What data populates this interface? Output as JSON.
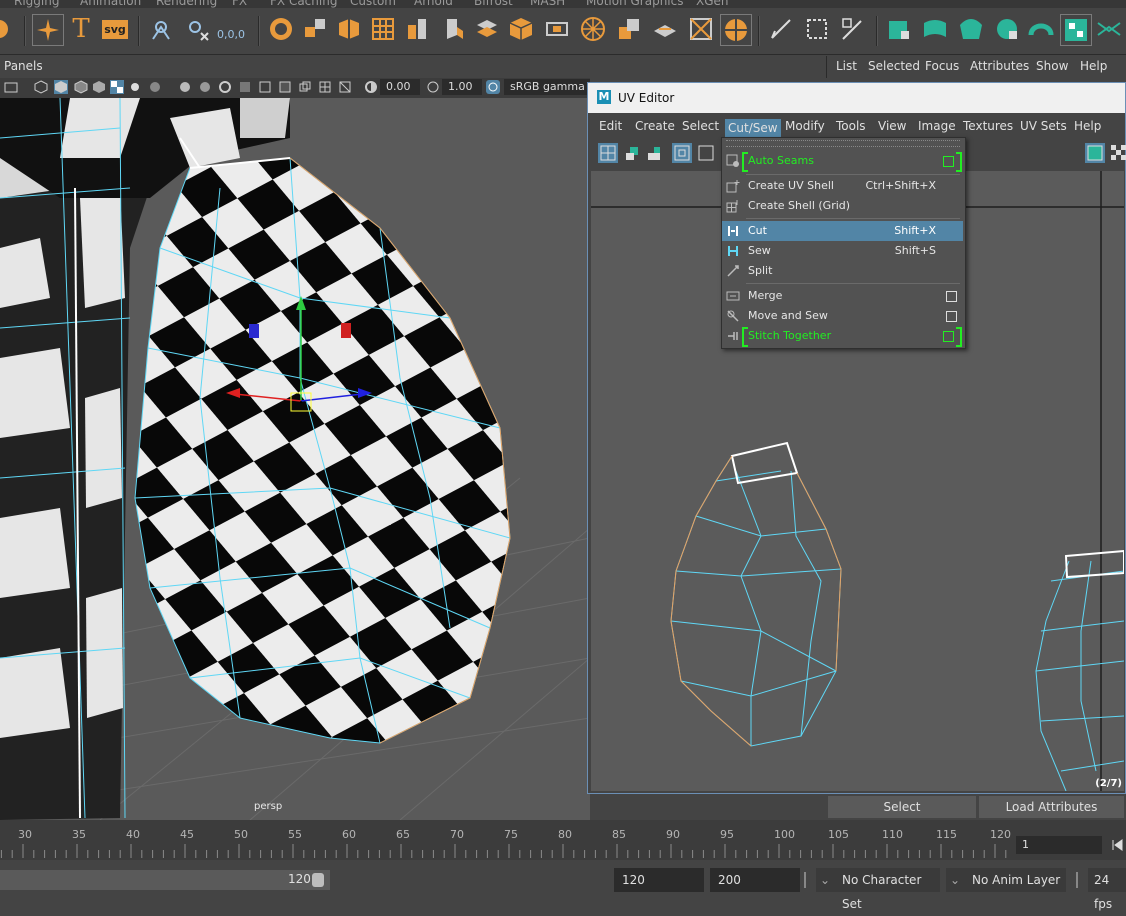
{
  "shelf_tabs": [
    "Rigging",
    "Animation",
    "Rendering",
    "FX",
    "FX Caching",
    "Custom",
    "Arnold",
    "Bifrost",
    "MASH",
    "Motion Graphics",
    "XGen"
  ],
  "shelf": {
    "text_tool_label": "T",
    "svg_tool_label": "svg",
    "snap_coords_label": "0,0,0"
  },
  "panel_menu": {
    "panels": "Panels"
  },
  "right_menu": {
    "items": [
      "List",
      "Selected",
      "Focus",
      "Attributes",
      "Show",
      "Help"
    ]
  },
  "panel_toolbar": {
    "exposure": "0.00",
    "gamma": "1.00",
    "color_space": "sRGB gamma"
  },
  "viewport": {
    "camera_label": "persp"
  },
  "uv_editor": {
    "title": "UV Editor",
    "menus": [
      "Edit",
      "Create",
      "Select",
      "Cut/Sew",
      "Modify",
      "Tools",
      "View",
      "Image",
      "Textures",
      "UV Sets",
      "Help"
    ],
    "active_menu": "Cut/Sew",
    "page_indicator": "(2/7)"
  },
  "cutsew_menu": {
    "auto_seams": "Auto Seams",
    "create_uv_shell": "Create UV Shell",
    "create_uv_shell_shortcut": "Ctrl+Shift+X",
    "create_shell_grid": "Create Shell (Grid)",
    "cut": "Cut",
    "cut_shortcut": "Shift+X",
    "sew": "Sew",
    "sew_shortcut": "Shift+S",
    "split": "Split",
    "merge": "Merge",
    "move_and_sew": "Move and Sew",
    "stitch_together": "Stitch Together"
  },
  "right_bottom": {
    "select": "Select",
    "load_attributes": "Load Attributes"
  },
  "timeline": {
    "ticks": [
      "30",
      "35",
      "40",
      "45",
      "50",
      "55",
      "60",
      "65",
      "70",
      "75",
      "80",
      "85",
      "90",
      "95",
      "100",
      "105",
      "110",
      "115",
      "120"
    ],
    "current_frame": "1"
  },
  "range_bar": {
    "range_end_slider": "120",
    "playback_end": "120",
    "anim_end": "200",
    "character_set": "No Character Set",
    "anim_layer": "No Anim Layer",
    "fps": "24 fps"
  },
  "colors": {
    "accent": "#5285a6",
    "highlight_green": "#22ee22",
    "wire_cyan": "#5fd7f5",
    "border_orange": "#e8a060"
  }
}
